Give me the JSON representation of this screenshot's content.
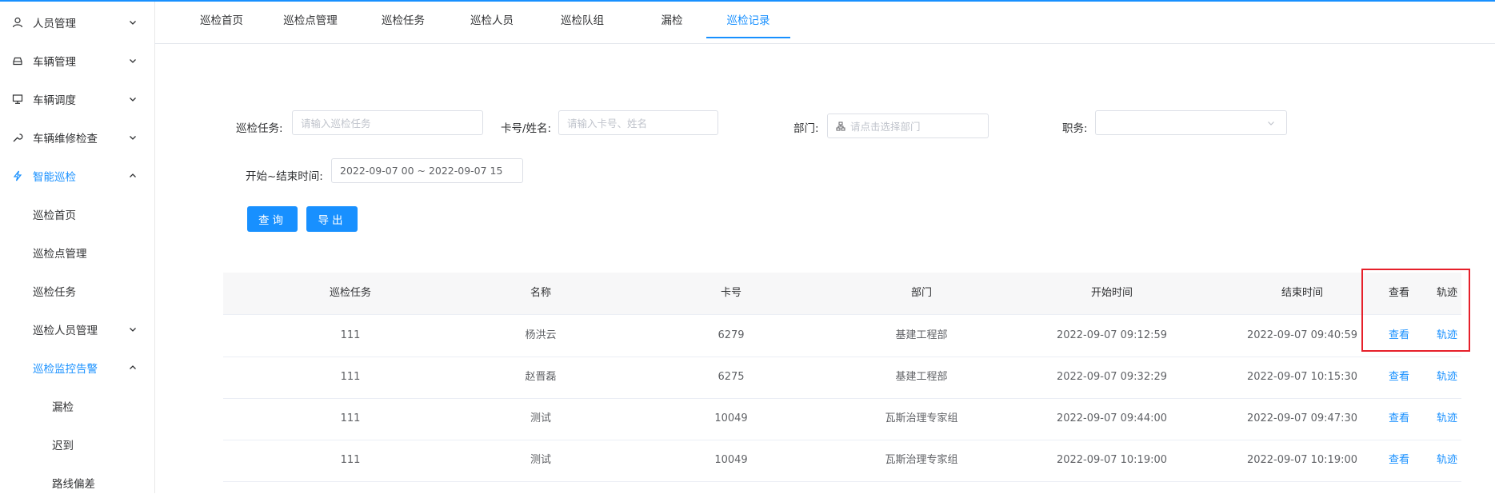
{
  "sidebar": {
    "items": [
      {
        "label": "人员管理",
        "icon": "user-icon"
      },
      {
        "label": "车辆管理",
        "icon": "car-icon"
      },
      {
        "label": "车辆调度",
        "icon": "monitor-icon"
      },
      {
        "label": "车辆维修检查",
        "icon": "wrench-icon"
      },
      {
        "label": "智能巡检",
        "icon": "lightning-icon"
      }
    ],
    "sub": [
      {
        "label": "巡检首页"
      },
      {
        "label": "巡检点管理"
      },
      {
        "label": "巡检任务"
      },
      {
        "label": "巡检人员管理"
      },
      {
        "label": "巡检监控告警"
      }
    ],
    "sub2": [
      {
        "label": "漏检"
      },
      {
        "label": "迟到"
      },
      {
        "label": "路线偏差"
      }
    ]
  },
  "tabs": [
    {
      "label": "巡检首页"
    },
    {
      "label": "巡检点管理"
    },
    {
      "label": "巡检任务"
    },
    {
      "label": "巡检人员"
    },
    {
      "label": "巡检队组"
    },
    {
      "label": "漏检"
    },
    {
      "label": "巡检记录"
    }
  ],
  "form": {
    "task_label": "巡检任务:",
    "task_placeholder": "请输入巡检任务",
    "card_label": "卡号/姓名:",
    "card_placeholder": "请输入卡号、姓名",
    "dept_label": "部门:",
    "dept_placeholder": "请点击选择部门",
    "position_label": "职务:",
    "time_label": "开始~结束时间:",
    "time_value": "2022-09-07 00 ~ 2022-09-07 15",
    "query_button": "查询",
    "export_button": "导出"
  },
  "table": {
    "headers": [
      "巡检任务",
      "名称",
      "卡号",
      "部门",
      "开始时间",
      "结束时间",
      "查看",
      "轨迹"
    ],
    "rows": [
      {
        "task": "111",
        "name": "杨洪云",
        "card": "6279",
        "dept": "基建工程部",
        "start": "2022-09-07 09:12:59",
        "end": "2022-09-07 09:40:59",
        "view": "查看",
        "track": "轨迹"
      },
      {
        "task": "111",
        "name": "赵晋磊",
        "card": "6275",
        "dept": "基建工程部",
        "start": "2022-09-07 09:32:29",
        "end": "2022-09-07 10:15:30",
        "view": "查看",
        "track": "轨迹"
      },
      {
        "task": "111",
        "name": "测试",
        "card": "10049",
        "dept": "瓦斯治理专家组",
        "start": "2022-09-07 09:44:00",
        "end": "2022-09-07 09:47:30",
        "view": "查看",
        "track": "轨迹"
      },
      {
        "task": "111",
        "name": "测试",
        "card": "10049",
        "dept": "瓦斯治理专家组",
        "start": "2022-09-07 10:19:00",
        "end": "2022-09-07 10:19:00",
        "view": "查看",
        "track": "轨迹"
      }
    ]
  },
  "colors": {
    "accent": "#1890ff",
    "highlight": "#e6202a"
  }
}
